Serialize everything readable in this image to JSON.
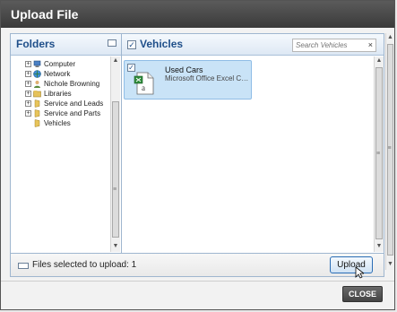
{
  "dialog": {
    "title": "Upload File",
    "close_label": "CLOSE"
  },
  "folders": {
    "title": "Folders",
    "items": [
      {
        "label": "Computer",
        "icon": "computer-icon",
        "expander": "+"
      },
      {
        "label": "Network",
        "icon": "network-icon",
        "expander": "+"
      },
      {
        "label": "Nichole Browning",
        "icon": "user-icon",
        "expander": "+"
      },
      {
        "label": "Libraries",
        "icon": "libraries-icon",
        "expander": "+"
      },
      {
        "label": "Service and Leads",
        "icon": "folder-icon",
        "expander": "+"
      },
      {
        "label": "Service and Parts",
        "icon": "folder-icon",
        "expander": "+"
      },
      {
        "label": "Vehicles",
        "icon": "folder-icon",
        "expander": ""
      }
    ]
  },
  "vehicles": {
    "title": "Vehicles",
    "search_placeholder": "Search Vehicles",
    "clear_glyph": "×",
    "files": [
      {
        "name": "Used Cars",
        "type": "Microsoft Office Excel Com...",
        "checked": true
      }
    ]
  },
  "status": {
    "text": "Files selected to upload: 1",
    "upload_label": "Upload"
  },
  "colors": {
    "accent": "#1f4f8a",
    "tile_bg": "#c9e3f7",
    "titlebar": "#3a3a3a"
  }
}
